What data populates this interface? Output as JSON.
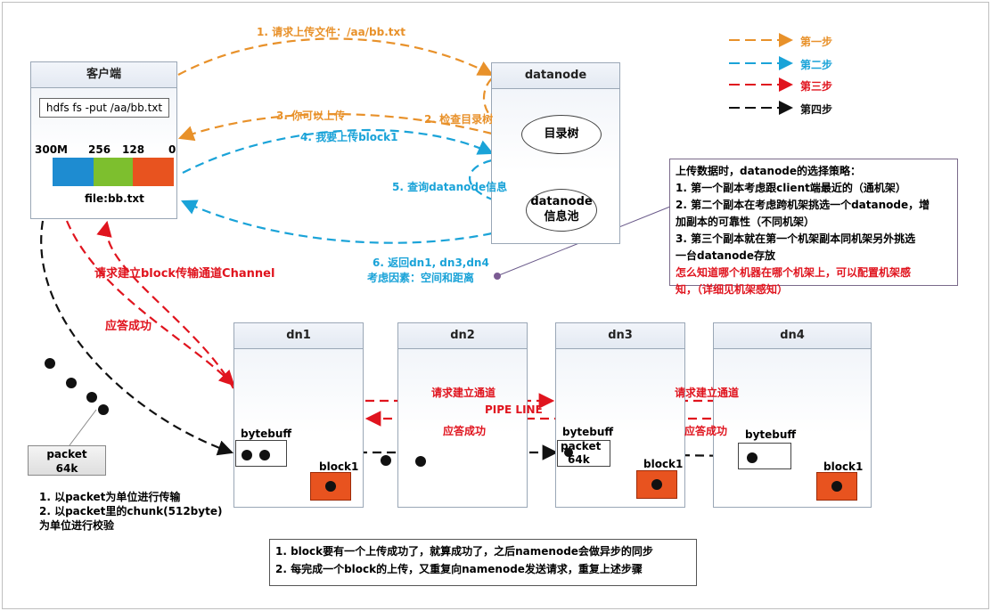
{
  "client": {
    "title": "客户端",
    "command": "hdfs  fs -put /aa/bb.txt",
    "scale": [
      "300M",
      "256",
      "128",
      "0"
    ],
    "file": "file:bb.txt",
    "segment_colors": [
      "#1e8cd1",
      "#7dbf2e",
      "#e8531f"
    ]
  },
  "namenode": {
    "title": "datanode",
    "tree": "目录树",
    "pool_line1": "datanode",
    "pool_line2": "信息池"
  },
  "steps": {
    "s1": "1. 请求上传文件：/aa/bb.txt",
    "s2": "2. 检查目录树",
    "s3": "3. 你可以上传",
    "s4": "4. 我要上传block1",
    "s5": "5. 查询datanode信息",
    "s6a": "6. 返回dn1, dn3,dn4",
    "s6b": "考虑因素：空间和距离"
  },
  "legend": [
    {
      "label": "第一步",
      "color": "#e8912a"
    },
    {
      "label": "第二步",
      "color": "#1aa3d8"
    },
    {
      "label": "第三步",
      "color": "#e0141e"
    },
    {
      "label": "第四步",
      "color": "#111111"
    }
  ],
  "strategy_note": {
    "line1": "上传数据时，datanode的选择策略：",
    "line2": "1. 第一个副本考虑跟client端最近的（通机架）",
    "line3": "2. 第二个副本在考虑跨机架挑选一个datanode，增",
    "line4": "加副本的可靠性（不同机架）",
    "line5": "3. 第三个副本就在第一个机架副本同机架另外挑选",
    "line6": "一台datanode存放",
    "line7": "怎么知道哪个机器在哪个机架上，可以配置机架感",
    "line8": "知，（详细见机架感知）"
  },
  "channel": {
    "request": "请求建立block传输通道Channel",
    "reply": "应答成功"
  },
  "datanodes": [
    {
      "title": "dn1",
      "buffer": "bytebuff",
      "block": "block1"
    },
    {
      "title": "dn2"
    },
    {
      "title": "dn3",
      "buffer": "bytebuff",
      "packet": "packet",
      "size": "64k",
      "block": "block1"
    },
    {
      "title": "dn4",
      "buffer": "bytebuff",
      "block": "block1"
    }
  ],
  "pipeline": {
    "request1": "请求建立通道",
    "reply1": "应答成功",
    "label": "PIPE LINE",
    "request2": "请求建立通道",
    "reply2": "应答成功"
  },
  "packet": {
    "line1": "packet",
    "line2": "64k"
  },
  "packet_note": {
    "line1": "1. 以packet为单位进行传输",
    "line2": "2. 以packet里的chunk(512byte)",
    "line3": "为单位进行校验"
  },
  "bottom_note": {
    "line1": "1. block要有一个上传成功了，就算成功了，之后namenode会做异步的同步",
    "line2": "2. 每完成一个block的上传，又重复向namenode发送请求，重复上述步骤"
  }
}
